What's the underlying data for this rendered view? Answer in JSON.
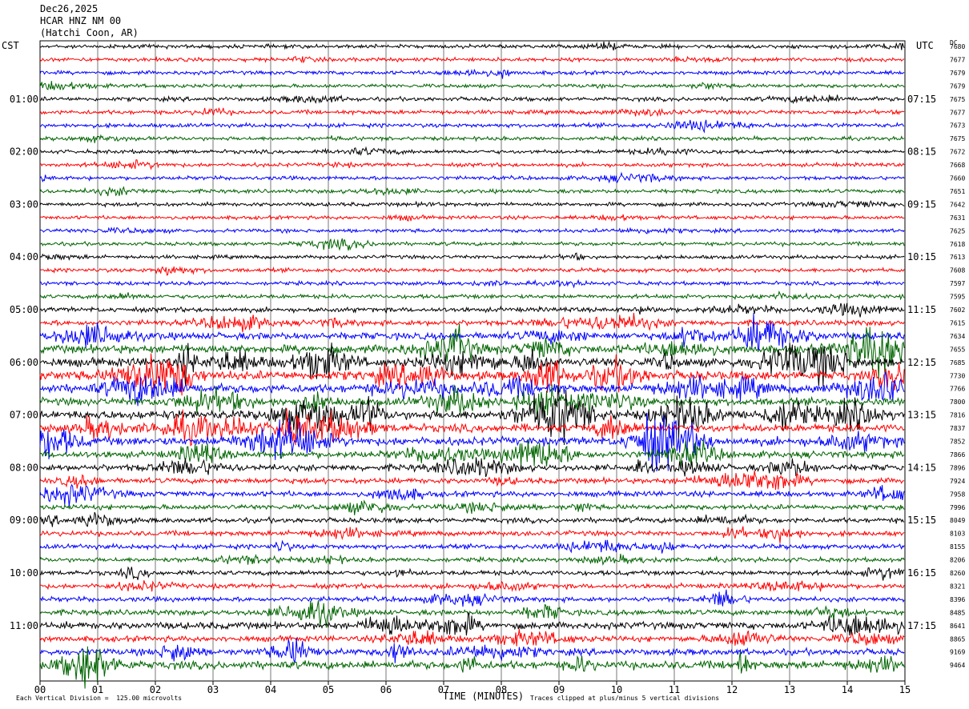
{
  "header": {
    "date": "Dec26,2025",
    "station": "HCAR HNZ NM 00",
    "location": "(Hatchi Coon, AR)"
  },
  "labels": {
    "left_tz": "CST",
    "right_tz": "UTC",
    "dc_label": "DC",
    "x_title": "TIME (MINUTES)",
    "division_note": "Each Vertical Division =  125.00 microvolts",
    "clip_note": "Traces clipped at plus/minus 5 vertical divisions"
  },
  "colors": {
    "trace_cycle": [
      "#000000",
      "#ff0000",
      "#0000ff",
      "#006400"
    ],
    "grid": "#000000",
    "background": "#ffffff"
  },
  "chart_data": {
    "type": "line",
    "title": "",
    "xlabel": "TIME (MINUTES)",
    "ylabel": "",
    "xlim": [
      0,
      15
    ],
    "x_ticks": [
      "00",
      "01",
      "02",
      "03",
      "04",
      "05",
      "06",
      "07",
      "08",
      "09",
      "10",
      "11",
      "12",
      "13",
      "14",
      "15"
    ],
    "left_time_labels": [
      {
        "row": 4,
        "label": "01:00"
      },
      {
        "row": 8,
        "label": "02:00"
      },
      {
        "row": 12,
        "label": "03:00"
      },
      {
        "row": 16,
        "label": "04:00"
      },
      {
        "row": 20,
        "label": "05:00"
      },
      {
        "row": 24,
        "label": "06:00"
      },
      {
        "row": 28,
        "label": "07:00"
      },
      {
        "row": 32,
        "label": "08:00"
      },
      {
        "row": 36,
        "label": "09:00"
      },
      {
        "row": 40,
        "label": "10:00"
      },
      {
        "row": 44,
        "label": "11:00"
      }
    ],
    "right_time_labels": [
      {
        "row": 4,
        "label": "07:15"
      },
      {
        "row": 8,
        "label": "08:15"
      },
      {
        "row": 12,
        "label": "09:15"
      },
      {
        "row": 16,
        "label": "10:15"
      },
      {
        "row": 20,
        "label": "11:15"
      },
      {
        "row": 24,
        "label": "12:15"
      },
      {
        "row": 28,
        "label": "13:15"
      },
      {
        "row": 32,
        "label": "14:15"
      },
      {
        "row": 36,
        "label": "15:15"
      },
      {
        "row": 40,
        "label": "16:15"
      },
      {
        "row": 44,
        "label": "17:15"
      }
    ],
    "dc_offsets": [
      "7680",
      "7677",
      "7679",
      "7679",
      "7675",
      "7677",
      "7673",
      "7675",
      "7672",
      "7668",
      "7660",
      "7651",
      "7642",
      "7631",
      "7625",
      "7618",
      "7613",
      "7608",
      "7597",
      "7595",
      "7602",
      "7615",
      "7634",
      "7655",
      "7685",
      "7730",
      "7766",
      "7800",
      "7816",
      "7837",
      "7852",
      "7866",
      "7896",
      "7924",
      "7958",
      "7996",
      "8049",
      "8103",
      "8155",
      "8206",
      "8260",
      "8321",
      "8396",
      "8485",
      "8641",
      "8865",
      "9169",
      "9464"
    ],
    "trace_activity": [
      0.2,
      0.2,
      0.2,
      0.2,
      0.25,
      0.25,
      0.25,
      0.2,
      0.2,
      0.2,
      0.2,
      0.2,
      0.2,
      0.18,
      0.18,
      0.18,
      0.2,
      0.22,
      0.2,
      0.25,
      0.35,
      0.45,
      0.7,
      0.9,
      1.0,
      1.0,
      0.95,
      0.8,
      1.0,
      0.85,
      0.9,
      0.65,
      0.6,
      0.45,
      0.45,
      0.4,
      0.4,
      0.4,
      0.35,
      0.3,
      0.35,
      0.35,
      0.35,
      0.45,
      0.7,
      0.5,
      0.6,
      0.85
    ]
  }
}
